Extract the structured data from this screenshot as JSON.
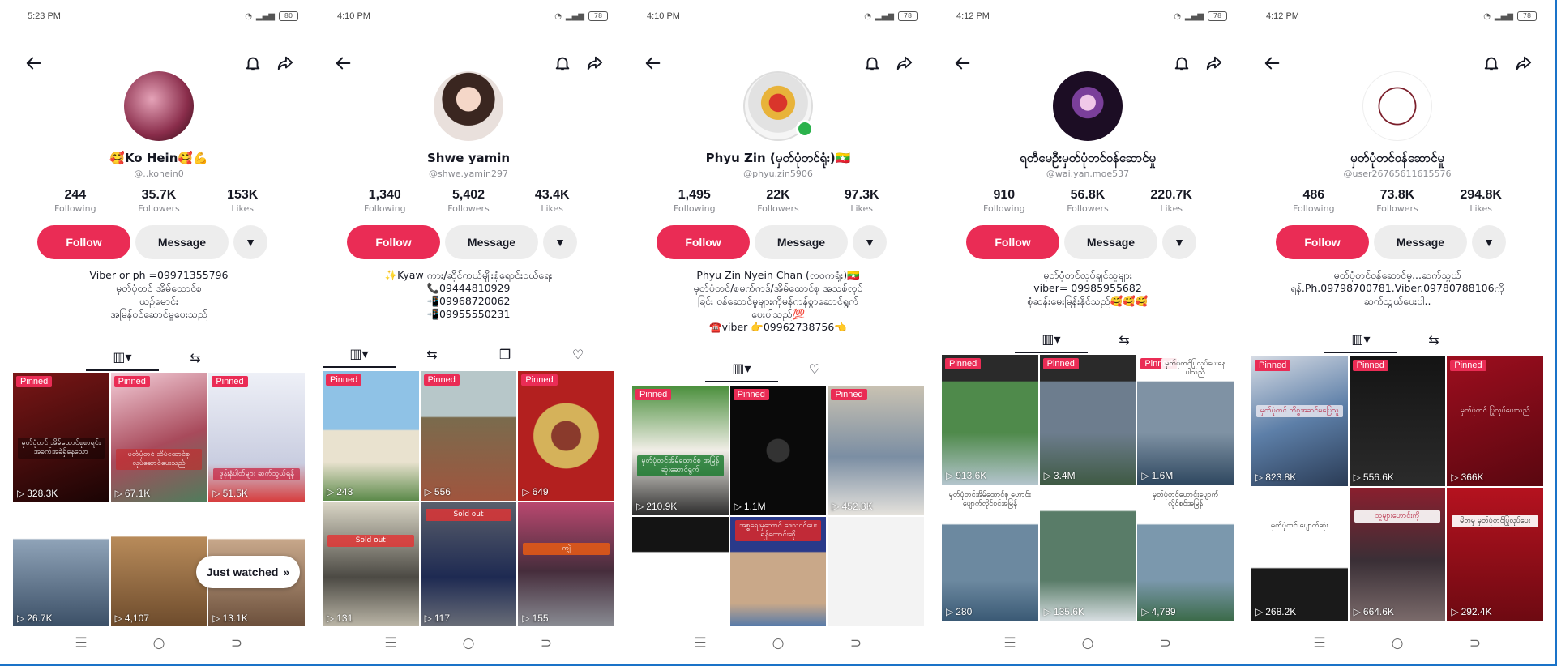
{
  "screens": [
    {
      "status_time": "5:23 PM",
      "battery": "80",
      "name": "🥰Ko Hein🥰💪",
      "handle": "@..kohein0",
      "stats": [
        {
          "num": "244",
          "label": "Following"
        },
        {
          "num": "35.7K",
          "label": "Followers"
        },
        {
          "num": "153K",
          "label": "Likes"
        }
      ],
      "follow": "Follow",
      "message": "Message",
      "bio": [
        "Viber or ph =09971355796",
        "မှတ်ပုံတင် အိမ်ထောင်စု",
        "ယဥ်မောင်း",
        "အမြန်ဝင်ဆောင်မှုပေးသည်"
      ],
      "views": [
        "328.3K",
        "67.1K",
        "51.5K",
        "26.7K",
        "4,107",
        "13.1K"
      ],
      "captions": [
        "မှတ်ပုံတင် အိမ်ထောင်စုစာရင်း အခက်အခဲရှိနေသော",
        "မှတ်ပုံတင် အိမ်ထောင်စု လုပ်ဆောင်ပေးသည်",
        "ဖုန်းနံပါတ်များ ဆက်သွယ်ရန်",
        "",
        "",
        ""
      ],
      "just_watched": "Just watched"
    },
    {
      "status_time": "4:10 PM",
      "battery": "78",
      "name": "Shwe yamin",
      "handle": "@shwe.yamin297",
      "stats": [
        {
          "num": "1,340",
          "label": "Following"
        },
        {
          "num": "5,402",
          "label": "Followers"
        },
        {
          "num": "43.4K",
          "label": "Likes"
        }
      ],
      "follow": "Follow",
      "message": "Message",
      "bio": [
        "✨Kyaw ကား/ဆိုင်ကယ်မျိုးစုံရောင်းဝယ်ရေး",
        "📞09444810929",
        "📲09968720062",
        "📲09955550231"
      ],
      "views": [
        "243",
        "556",
        "649",
        "131",
        "117",
        "155"
      ],
      "captions": [
        "",
        "",
        "",
        "Sold out",
        "Sold out",
        "ကျွဲ"
      ]
    },
    {
      "status_time": "4:10 PM",
      "battery": "78",
      "name": "Phyu Zin (မှတ်ပုံတင်ရုံး)🇲🇲",
      "handle": "@phyu.zin5906",
      "stats": [
        {
          "num": "1,495",
          "label": "Following"
        },
        {
          "num": "22K",
          "label": "Followers"
        },
        {
          "num": "97.3K",
          "label": "Likes"
        }
      ],
      "follow": "Follow",
      "message": "Message",
      "bio": [
        "Phyu Zin Nyein Chan (လဝကရုံး)🇲🇲",
        "မှတ်ပုံတင်/စမက်ကဒ်/အိမ်ထောင်စု အသစ်လုပ်",
        "ခြင်း ဝန်ဆောင်မှုများကိုမှန်ကန်စွာဆောင်ရွက်",
        "ပေးပါသည်💯",
        "☎️viber 👉09962738756👈"
      ],
      "views": [
        "210.9K",
        "1.1M",
        "452.3K"
      ],
      "captions": [
        "မှတ်ပုံတင်အိမ်ထောင်စု အမြန်ဆုံးဆောင်ရွက်",
        "",
        "",
        "",
        "အစ္စရေးမှဘောင် ဒေသဝင်ပေးရန်တောင်းဆို",
        ""
      ]
    },
    {
      "status_time": "4:12 PM",
      "battery": "78",
      "name": "ရတီမေဦးမှတ်ပုံတင်ဝန်ဆောင်မှု",
      "handle": "@wai.yan.moe537",
      "stats": [
        {
          "num": "910",
          "label": "Following"
        },
        {
          "num": "56.8K",
          "label": "Followers"
        },
        {
          "num": "220.7K",
          "label": "Likes"
        }
      ],
      "follow": "Follow",
      "message": "Message",
      "bio": [
        "မှတ်ပုံတင်လုပ်ချင်သူများ",
        "viber= 09985955682",
        "စုံဆန်းမေးမြန်းနိုင်သည်🥰🥰🥰"
      ],
      "views": [
        "913.6K",
        "3.4M",
        "1.6M",
        "280",
        "135.6K",
        "4,789"
      ],
      "captions": [
        "",
        "",
        "မှတ်ပုံတင်ပြုလုပ်ပေးနေပါသည်",
        "မှတ်ပုံတင်အိမ်ထောင်စု ဟောင်းပျောက်လိုင်စင်အမြန်",
        "",
        "မှတ်ပုံတင်ဟောင်းပျောက် လိုင်စင်အမြန်"
      ]
    },
    {
      "status_time": "4:12 PM",
      "battery": "78",
      "name": "မှတ်ပုံတင်ဝန်ဆောင်မှု",
      "handle": "@user26765611615576",
      "stats": [
        {
          "num": "486",
          "label": "Following"
        },
        {
          "num": "73.8K",
          "label": "Followers"
        },
        {
          "num": "294.8K",
          "label": "Likes"
        }
      ],
      "follow": "Follow",
      "message": "Message",
      "bio": [
        "မှတ်ပုံတင်ဝန်ဆောင်မှု...ဆက်သွယ်",
        "ရန်.Ph.09798700781.Viber.09780788106ကို",
        "ဆက်သွယ်ပေးပါ.."
      ],
      "views": [
        "823.8K",
        "556.6K",
        "366K",
        "268.2K",
        "664.6K",
        "292.4K"
      ],
      "captions": [
        "မှတ်ပုံတင် ကိစ္စအဆင်မပြေသူ",
        "",
        "မှတ်ပုံတင် ပြုလုပ်ပေးသည်",
        "မှတ်ပုံတင် ပျောက်ဆုံး",
        "သူများဟောင်းကို",
        "မိဘမှ မှတ်ပုံတင်ပြုလုပ်ပေး"
      ]
    }
  ],
  "pinned_label": "Pinned",
  "icons": {
    "back": "arrow-left-icon",
    "bell": "bell-icon",
    "share": "share-icon",
    "grid": "grid-icon",
    "repost": "repost-icon",
    "bookmark": "bookmark-icon",
    "like": "heart-icon",
    "play": "play-icon"
  },
  "colors": {
    "follow": "#ea2c55",
    "pinned": "#ea2c55",
    "online": "#2bb24c"
  }
}
